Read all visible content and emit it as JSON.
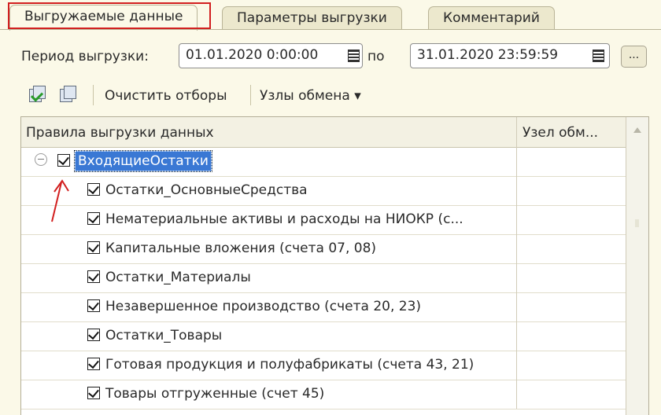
{
  "tabs": [
    {
      "label": "Выгружаемые данные",
      "active": true
    },
    {
      "label": "Параметры выгрузки",
      "active": false
    },
    {
      "label": "Комментарий",
      "active": false
    }
  ],
  "period": {
    "label": "Период выгрузки:",
    "from": "01.01.2020  0:00:00",
    "to_label": "по",
    "to": "31.01.2020 23:59:59",
    "more_label": "..."
  },
  "toolbar": {
    "check_all_icon": "check-all-icon",
    "uncheck_all_icon": "uncheck-all-icon",
    "clear_filters_label": "Очистить отборы",
    "exchange_nodes_label": "Узлы обмена ▾"
  },
  "grid": {
    "col1_header": "Правила выгрузки данных",
    "col2_header": "Узел обм...",
    "rows": [
      {
        "label": "ВходящиеОстатки",
        "checked": true
      },
      {
        "label": "Остатки_ОсновныеСредства",
        "checked": true
      },
      {
        "label": "Нематериальные активы и расходы на НИОКР (с...",
        "checked": true
      },
      {
        "label": "Капитальные вложения (счета 07, 08)",
        "checked": true
      },
      {
        "label": "Остатки_Материалы",
        "checked": true
      },
      {
        "label": "Незавершенное производство (счета 20, 23)",
        "checked": true
      },
      {
        "label": "Остатки_Товары",
        "checked": true
      },
      {
        "label": "Готовая продукция и полуфабрикаты (счета 43, 21)",
        "checked": true
      },
      {
        "label": "Товары отгруженные (счет 45)",
        "checked": true
      }
    ]
  },
  "colors": {
    "highlight": "#d21f1f",
    "selection": "#3a78d4",
    "background": "#fbf9e8"
  }
}
